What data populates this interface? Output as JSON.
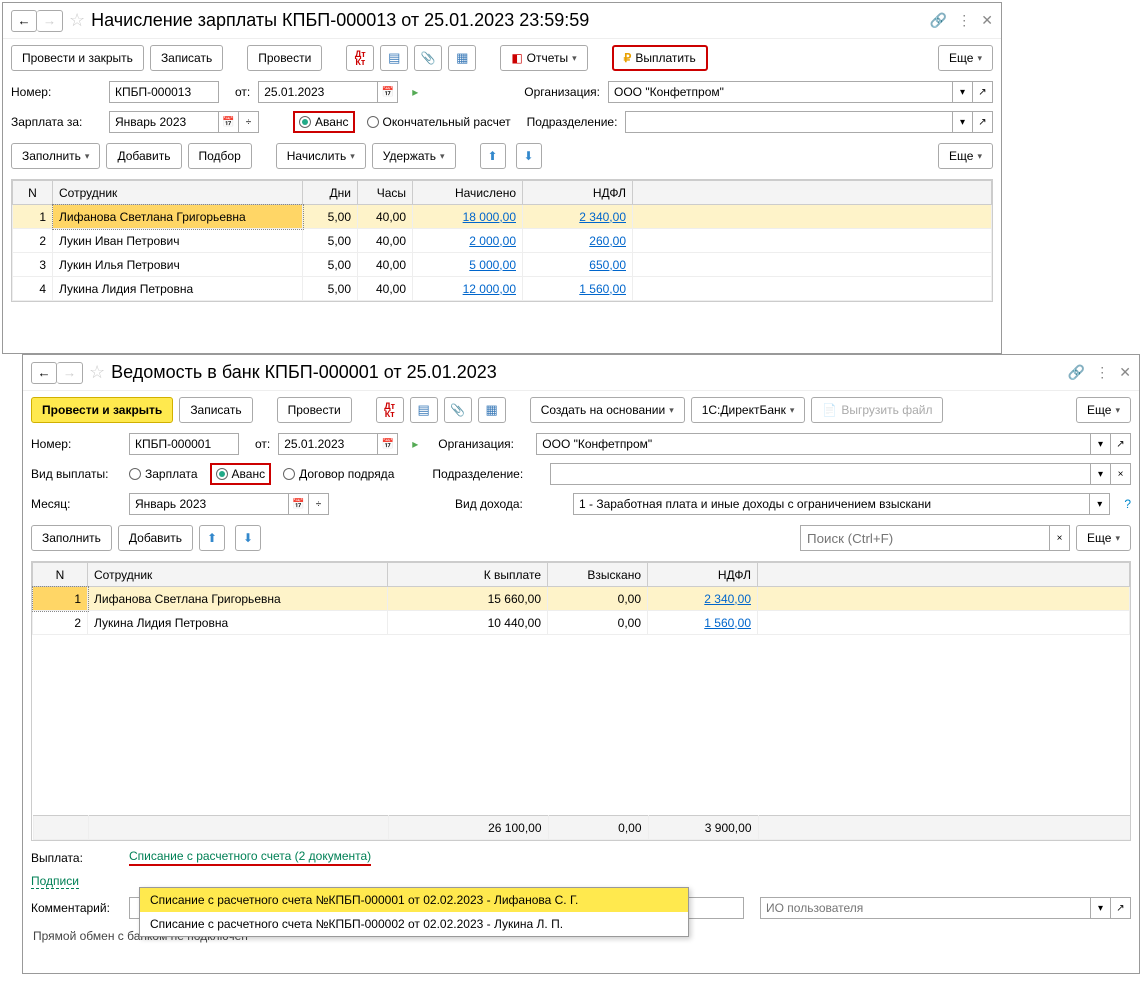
{
  "win1": {
    "title": "Начисление зарплаты КПБП-000013 от 25.01.2023 23:59:59",
    "toolbar": {
      "post_close": "Провести и закрыть",
      "save": "Записать",
      "post": "Провести",
      "reports": "Отчеты",
      "pay": "Выплатить",
      "more": "Еще"
    },
    "number_lbl": "Номер:",
    "number": "КПБП-000013",
    "from_lbl": "от:",
    "date": "25.01.2023",
    "org_lbl": "Организация:",
    "org": "ООО \"Конфетпром\"",
    "salary_for_lbl": "Зарплата за:",
    "salary_for": "Январь 2023",
    "radio_advance": "Аванс",
    "radio_final": "Окончательный расчет",
    "subdiv_lbl": "Подразделение:",
    "fill": "Заполнить",
    "add": "Добавить",
    "pick": "Подбор",
    "accrue": "Начислить",
    "deduct": "Удержать",
    "more2": "Еще",
    "cols": {
      "n": "N",
      "emp": "Сотрудник",
      "days": "Дни",
      "hours": "Часы",
      "accrued": "Начислено",
      "ndfl": "НДФЛ"
    },
    "rows": [
      {
        "n": "1",
        "emp": "Лифанова Светлана Григорьевна",
        "days": "5,00",
        "hours": "40,00",
        "accrued": "18 000,00",
        "ndfl": "2 340,00"
      },
      {
        "n": "2",
        "emp": "Лукин Иван Петрович",
        "days": "5,00",
        "hours": "40,00",
        "accrued": "2 000,00",
        "ndfl": "260,00"
      },
      {
        "n": "3",
        "emp": "Лукин Илья Петрович",
        "days": "5,00",
        "hours": "40,00",
        "accrued": "5 000,00",
        "ndfl": "650,00"
      },
      {
        "n": "4",
        "emp": "Лукина Лидия Петровна",
        "days": "5,00",
        "hours": "40,00",
        "accrued": "12 000,00",
        "ndfl": "1 560,00"
      }
    ]
  },
  "win2": {
    "title": "Ведомость в банк КПБП-000001 от 25.01.2023",
    "toolbar": {
      "post_close": "Провести и закрыть",
      "save": "Записать",
      "post": "Провести",
      "create_on": "Создать на основании",
      "directbank": "1С:ДиректБанк",
      "export": "Выгрузить файл",
      "more": "Еще"
    },
    "number_lbl": "Номер:",
    "number": "КПБП-000001",
    "from_lbl": "от:",
    "date": "25.01.2023",
    "org_lbl": "Организация:",
    "org": "ООО \"Конфетпром\"",
    "paytype_lbl": "Вид выплаты:",
    "radio_salary": "Зарплата",
    "radio_advance": "Аванс",
    "radio_contract": "Договор подряда",
    "subdiv_lbl": "Подразделение:",
    "month_lbl": "Месяц:",
    "month": "Январь 2023",
    "income_lbl": "Вид дохода:",
    "income": "1 - Заработная плата и иные доходы с ограничением взыскани",
    "fill": "Заполнить",
    "add": "Добавить",
    "search_ph": "Поиск (Ctrl+F)",
    "more2": "Еще",
    "cols": {
      "n": "N",
      "emp": "Сотрудник",
      "topay": "К выплате",
      "collected": "Взыскано",
      "ndfl": "НДФЛ"
    },
    "rows": [
      {
        "n": "1",
        "emp": "Лифанова Светлана Григорьевна",
        "topay": "15 660,00",
        "collected": "0,00",
        "ndfl": "2 340,00"
      },
      {
        "n": "2",
        "emp": "Лукина Лидия Петровна",
        "topay": "10 440,00",
        "collected": "0,00",
        "ndfl": "1 560,00"
      }
    ],
    "totals": {
      "topay": "26 100,00",
      "collected": "0,00",
      "ndfl": "3 900,00"
    },
    "payout_lbl": "Выплата:",
    "payout_link": "Списание с расчетного счета (2 документа)",
    "signatures": "Подписи",
    "dropdown": [
      "Списание с расчетного счета №КПБП-000001 от 02.02.2023 - Лифанова С. Г.",
      "Списание с расчетного счета №КПБП-000002 от 02.02.2023 - Лукина Л. П."
    ],
    "comment_lbl": "Комментарий:",
    "user_ph": "ИО пользователя",
    "status": "Прямой обмен с банком не подключен"
  }
}
